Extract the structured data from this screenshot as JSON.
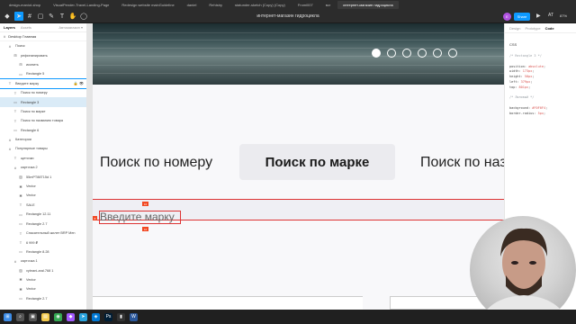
{
  "browser_tabs": [
    "design-maniot-shop",
    "VisualPender-Travel-Landing-Page",
    "Redesign website mainGuideline",
    "daniel",
    "Rehistry",
    "statunder-sketch (Copy) (Copy)",
    "Fromi007",
    "всг",
    "интернет-магазин гидроцикла"
  ],
  "toolbar": {
    "doc_title": "интернет-магазин гидроцикла",
    "share_label": "Share",
    "avatar_initial": "E",
    "zoom": "87%",
    "present_label": "АТ"
  },
  "layers_panel": {
    "tabs": [
      "Layers",
      "Assets"
    ],
    "page_name": "Автомагазин ▾",
    "page_label": "Desktop Главная",
    "rows": [
      {
        "icon": "#",
        "label": "Поиск",
        "indent": 1,
        "state": ""
      },
      {
        "icon": "⊞",
        "label": "рефинанировать",
        "indent": 2,
        "state": ""
      },
      {
        "icon": "⊞",
        "label": "иконить",
        "indent": 3,
        "state": ""
      },
      {
        "icon": "▭",
        "label": "Rectangle 5",
        "indent": 3,
        "state": ""
      },
      {
        "icon": "T",
        "label": "Введите марку",
        "indent": 1,
        "state": "hover"
      },
      {
        "icon": "T",
        "label": "Поиск по номеру",
        "indent": 2,
        "state": ""
      },
      {
        "icon": "▭",
        "label": "Rectangle 3",
        "indent": 2,
        "state": "selected"
      },
      {
        "icon": "T",
        "label": "Поиск по марке",
        "indent": 2,
        "state": ""
      },
      {
        "icon": "T",
        "label": "Поиск по названию товара",
        "indent": 2,
        "state": ""
      },
      {
        "icon": "▭",
        "label": "Rectangle 6",
        "indent": 2,
        "state": ""
      },
      {
        "icon": "#",
        "label": "Категории",
        "indent": 1,
        "state": ""
      },
      {
        "icon": "#",
        "label": "Популярные товары",
        "indent": 1,
        "state": ""
      },
      {
        "icon": "T",
        "label": "щеточки",
        "indent": 2,
        "state": ""
      },
      {
        "icon": "#",
        "label": "карточка 2",
        "indent": 2,
        "state": ""
      },
      {
        "icon": "▨",
        "label": "55mPT88T15d 1",
        "indent": 3,
        "state": ""
      },
      {
        "icon": "✱",
        "label": "Vector",
        "indent": 3,
        "state": ""
      },
      {
        "icon": "✱",
        "label": "Vector",
        "indent": 3,
        "state": ""
      },
      {
        "icon": "T",
        "label": "SALE",
        "indent": 3,
        "state": ""
      },
      {
        "icon": "▭",
        "label": "Rectangle 12.11",
        "indent": 3,
        "state": ""
      },
      {
        "icon": "▭",
        "label": "Rectangle 2.7",
        "indent": 3,
        "state": ""
      },
      {
        "icon": "T",
        "label": "Спасательный жилет BRP Men",
        "indent": 3,
        "state": ""
      },
      {
        "icon": "T",
        "label": "6 999 ₽",
        "indent": 3,
        "state": ""
      },
      {
        "icon": "▭",
        "label": "Rectangle 8.28",
        "indent": 3,
        "state": ""
      },
      {
        "icon": "#",
        "label": "карточка 1",
        "indent": 2,
        "state": ""
      },
      {
        "icon": "▨",
        "label": "vybrani-aral.768 1",
        "indent": 3,
        "state": ""
      },
      {
        "icon": "✱",
        "label": "Vector",
        "indent": 3,
        "state": ""
      },
      {
        "icon": "✱",
        "label": "Vector",
        "indent": 3,
        "state": ""
      },
      {
        "icon": "▭",
        "label": "Rectangle 2.7",
        "indent": 3,
        "state": ""
      }
    ]
  },
  "canvas": {
    "search_tabs": {
      "left": "Поиск по  номеру",
      "active": "Поиск по марке",
      "right": "Поиск по наз"
    },
    "input_text": "Введите марку",
    "red_tag_top": "16",
    "red_tag_bottom": "16",
    "red_tag_left": "8",
    "slider_dots": 6,
    "active_dot": 0,
    "accent_red": "#d33333",
    "selection_blue": "#0d99ff"
  },
  "inspect_panel": {
    "tabs": [
      "Design",
      "Prototype",
      "Code"
    ],
    "active_tab": "Code",
    "css_label": "CSS",
    "comment1": "/* Rectangle 3 */",
    "lines1": [
      [
        "position",
        "absolute"
      ],
      [
        "width",
        "173px"
      ],
      [
        "height",
        "50px"
      ],
      [
        "left",
        "379px"
      ],
      [
        "top",
        "801px"
      ]
    ],
    "comment2": "/* Лиловый */",
    "lines2": [
      [
        "background",
        "#F0F0F4"
      ],
      [
        "border-radius",
        "5px"
      ]
    ]
  },
  "taskbar_icons": [
    "windows-icon",
    "search-icon",
    "task-view-icon",
    "file-explorer-icon",
    "chrome-icon",
    "figma-icon",
    "telegram-icon",
    "vscode-icon",
    "photoshop-icon",
    "terminal-icon",
    "word-icon"
  ]
}
